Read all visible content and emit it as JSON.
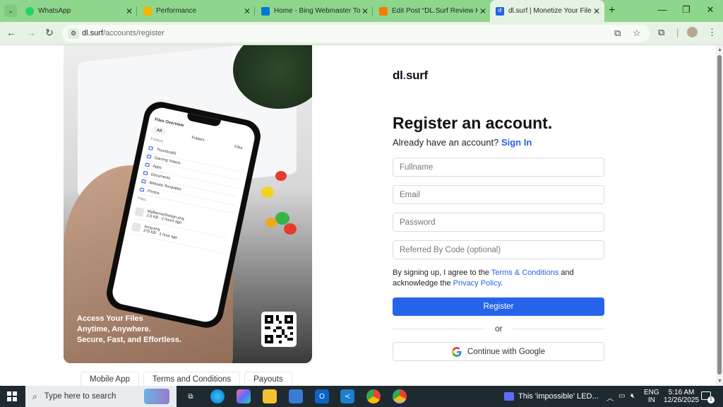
{
  "browser": {
    "tabs": [
      {
        "title": "WhatsApp",
        "color": "#25d366"
      },
      {
        "title": "Performance",
        "color": "#f4b400"
      },
      {
        "title": "Home - Bing Webmaster Too",
        "color": "#0078d4"
      },
      {
        "title": "Edit Post “DL.Surf Review Ho",
        "color": "#f57c00"
      },
      {
        "title": "dl.surf | Monetize Your Files",
        "color": "#2563eb"
      }
    ],
    "active_tab_index": 4,
    "address": {
      "host": "dl.surf",
      "path": "/accounts/register"
    }
  },
  "hero": {
    "caption": [
      "Access Your Files",
      "Anytime, Anywhere.",
      "Secure, Fast, and Effortless."
    ],
    "phone": {
      "title": "Files Overview",
      "tabs": [
        "All",
        "Folders",
        "Files"
      ],
      "folders_label": "Folders",
      "folders": [
        "Thumbnails",
        "Gaming Videos",
        "Apps",
        "Documents",
        "Website Templates",
        "Photos"
      ],
      "files_label": "Files",
      "files": [
        {
          "name": "MyBannerDesign.png",
          "size": "2.5 KB",
          "when": "2 hours ago"
        },
        {
          "name": "song.png",
          "size": "275 KB",
          "when": "1 hour ago"
        }
      ]
    }
  },
  "footer_links": [
    "Mobile App",
    "Terms and Conditions",
    "Payouts"
  ],
  "form": {
    "brand_main": "dl",
    "brand_dot": ".",
    "brand_tail": "surf",
    "title": "Register an account.",
    "subtitle": "Already have an account?",
    "signin_label": "Sign In",
    "fields": {
      "fullname": "Fullname",
      "email": "Email",
      "password": "Password",
      "referral": "Referred By Code (optional)"
    },
    "terms_prefix": "By signing up, I agree to the",
    "terms_link": "Terms & Conditions",
    "terms_mid": "and acknowledge the",
    "privacy_link": "Privacy Policy",
    "terms_suffix": ".",
    "register_label": "Register",
    "or_label": "or",
    "google_label": "Continue with Google",
    "accent": "#2563eb"
  },
  "taskbar": {
    "search_placeholder": "Type here to search",
    "news": "This 'impossible' LED...",
    "lang": [
      "ENG",
      "IN"
    ],
    "time": "5:16 AM",
    "date": "12/26/2025",
    "notifications": "1"
  }
}
